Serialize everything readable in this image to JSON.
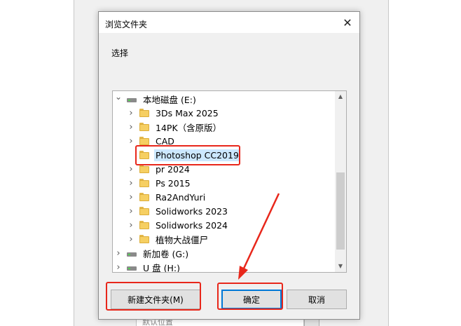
{
  "background": {
    "field_text": "默认位置"
  },
  "dialog": {
    "title": "浏览文件夹",
    "close_glyph": "✕",
    "prompt": "选择",
    "tree": [
      {
        "label": "本地磁盘 (E:)",
        "kind": "drive",
        "expander": "expanded",
        "level": 0
      },
      {
        "label": "3Ds Max 2025",
        "kind": "folder",
        "expander": "collapsed",
        "level": 1
      },
      {
        "label": "14PK（含原版）",
        "kind": "folder",
        "expander": "collapsed",
        "level": 1
      },
      {
        "label": "CAD",
        "kind": "folder",
        "expander": "collapsed",
        "level": 1
      },
      {
        "label": "Photoshop CC2019",
        "kind": "folder",
        "expander": "none",
        "level": 1,
        "selected": true
      },
      {
        "label": "pr 2024",
        "kind": "folder",
        "expander": "collapsed",
        "level": 1
      },
      {
        "label": "Ps 2015",
        "kind": "folder",
        "expander": "collapsed",
        "level": 1
      },
      {
        "label": "Ra2AndYuri",
        "kind": "folder",
        "expander": "collapsed",
        "level": 1
      },
      {
        "label": "Solidworks 2023",
        "kind": "folder",
        "expander": "collapsed",
        "level": 1
      },
      {
        "label": "Solidworks 2024",
        "kind": "folder",
        "expander": "collapsed",
        "level": 1
      },
      {
        "label": "植物大战僵尸",
        "kind": "folder",
        "expander": "collapsed",
        "level": 1
      },
      {
        "label": "新加卷 (G:)",
        "kind": "drive",
        "expander": "collapsed",
        "level": 0
      },
      {
        "label": "U 盘 (H:)",
        "kind": "drive",
        "expander": "collapsed",
        "level": 0
      }
    ],
    "buttons": {
      "new_folder": "新建文件夹(M)",
      "ok": "确定",
      "cancel": "取消"
    }
  },
  "colors": {
    "selection": "#cce8ff",
    "highlight_box": "#e8271b",
    "focus_border": "#0078d7"
  }
}
